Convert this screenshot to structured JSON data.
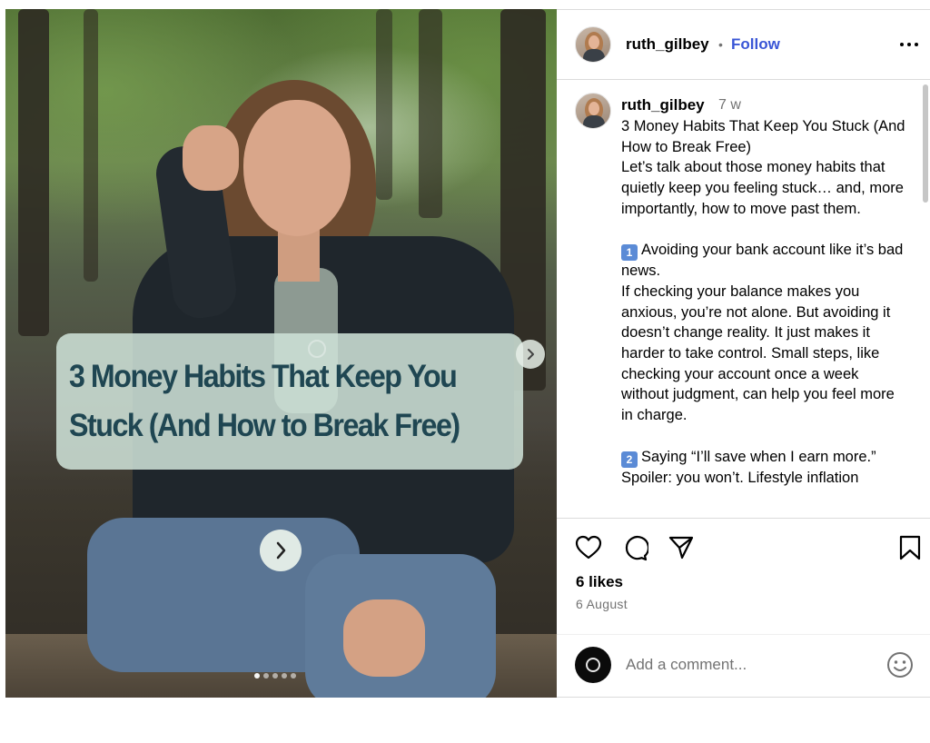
{
  "post": {
    "username": "ruth_gilbey",
    "follow_separator": "•",
    "follow_label": "Follow",
    "time_ago": "7 w",
    "overlay_title": "3 Money Habits That Keep You\nStuck (And How to Break Free)",
    "caption": {
      "title_line": "3 Money Habits That Keep You Stuck (And How to Break Free)",
      "intro": "Let’s talk about those money habits that quietly keep you feeling stuck… and, more importantly, how to move past them.",
      "habit1_num": "1",
      "habit1_title": "Avoiding your bank account like it’s bad news.",
      "habit1_body": "If checking your balance makes you anxious, you’re not alone. But avoiding it doesn’t change reality. It just makes it harder to take control. Small steps, like checking your account once a week without judgment, can help you feel more in charge.",
      "habit2_num": "2",
      "habit2_title": "Saying “I’ll save when I earn more.”",
      "habit2_body": "Spoiler: you won’t. Lifestyle inflation"
    },
    "likes": "6 likes",
    "date": "6 August",
    "carousel": {
      "total_slides": 5,
      "active_slide": 1
    }
  },
  "comment": {
    "placeholder": "Add a comment..."
  },
  "icons": {
    "more": "more-options-icon",
    "like": "heart-icon",
    "comment": "comment-bubble-icon",
    "share": "paper-plane-icon",
    "save": "bookmark-icon",
    "emoji": "emoji-smiley-icon",
    "next": "chevron-right-icon"
  },
  "colors": {
    "follow": "#3a56d6",
    "muted": "#737373",
    "overlay_text": "#1f4652",
    "overlay_card": "#cde0d6"
  }
}
